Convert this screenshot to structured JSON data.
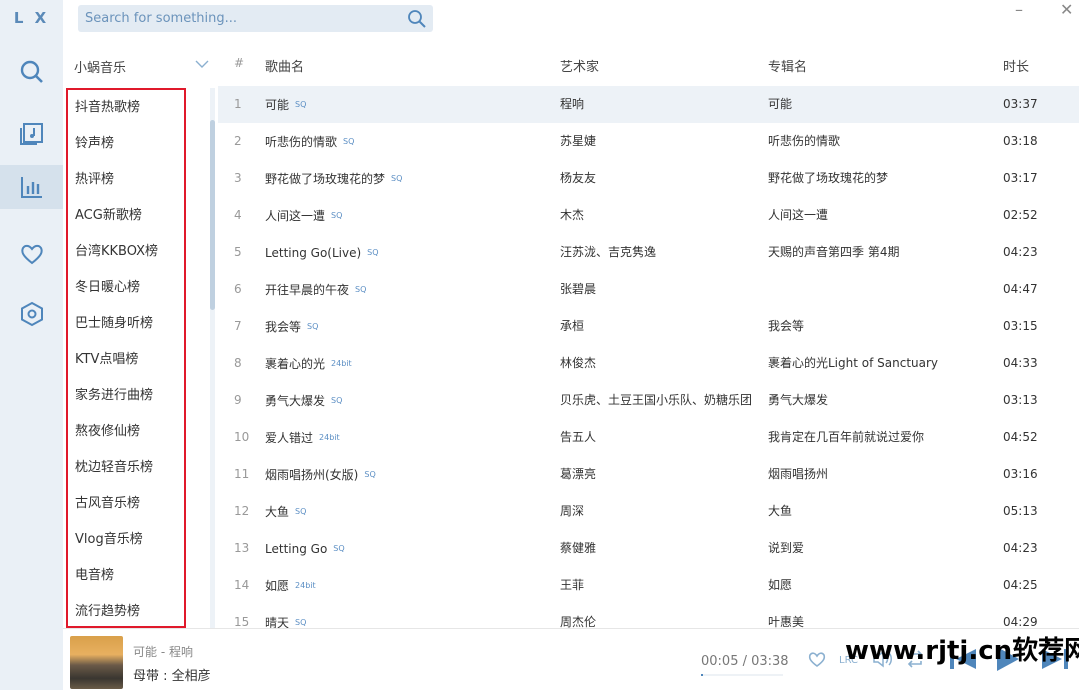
{
  "app": {
    "logo": "L X"
  },
  "search": {
    "placeholder": "Search for something..."
  },
  "source": {
    "selected": "小蜗音乐"
  },
  "boards": [
    "抖音热歌榜",
    "铃声榜",
    "热评榜",
    "ACG新歌榜",
    "台湾KKBOX榜",
    "冬日暖心榜",
    "巴士随身听榜",
    "KTV点唱榜",
    "家务进行曲榜",
    "熬夜修仙榜",
    "枕边轻音乐榜",
    "古风音乐榜",
    "Vlog音乐榜",
    "电音榜",
    "流行趋势榜"
  ],
  "table": {
    "headers": [
      "#",
      "歌曲名",
      "艺术家",
      "专辑名",
      "时长"
    ],
    "rows": [
      {
        "n": "1",
        "title": "可能",
        "q": "SQ",
        "artist": "程响",
        "album": "可能",
        "dur": "03:37"
      },
      {
        "n": "2",
        "title": "听悲伤的情歌",
        "q": "SQ",
        "artist": "苏星婕",
        "album": "听悲伤的情歌",
        "dur": "03:18"
      },
      {
        "n": "3",
        "title": "野花做了场玫瑰花的梦",
        "q": "SQ",
        "artist": "杨友友",
        "album": "野花做了场玫瑰花的梦",
        "dur": "03:17"
      },
      {
        "n": "4",
        "title": "人间这一遭",
        "q": "SQ",
        "artist": "木杰",
        "album": "人间这一遭",
        "dur": "02:52"
      },
      {
        "n": "5",
        "title": "Letting Go(Live)",
        "q": "SQ",
        "artist": "汪苏泷、吉克隽逸",
        "album": "天赐的声音第四季 第4期",
        "dur": "04:23"
      },
      {
        "n": "6",
        "title": "开往早晨的午夜",
        "q": "SQ",
        "artist": "张碧晨",
        "album": "",
        "dur": "04:47"
      },
      {
        "n": "7",
        "title": "我会等",
        "q": "SQ",
        "artist": "承桓",
        "album": "我会等",
        "dur": "03:15"
      },
      {
        "n": "8",
        "title": "裹着心的光",
        "q": "24bit",
        "artist": "林俊杰",
        "album": "裹着心的光Light of Sanctuary",
        "dur": "04:33"
      },
      {
        "n": "9",
        "title": "勇气大爆发",
        "q": "SQ",
        "artist": "贝乐虎、土豆王国小乐队、奶糖乐团",
        "album": "勇气大爆发",
        "dur": "03:13"
      },
      {
        "n": "10",
        "title": "爱人错过",
        "q": "24bit",
        "artist": "告五人",
        "album": "我肯定在几百年前就说过爱你",
        "dur": "04:52"
      },
      {
        "n": "11",
        "title": "烟雨唱扬州(女版)",
        "q": "SQ",
        "artist": "葛漂亮",
        "album": "烟雨唱扬州",
        "dur": "03:16"
      },
      {
        "n": "12",
        "title": "大鱼",
        "q": "SQ",
        "artist": "周深",
        "album": "大鱼",
        "dur": "05:13"
      },
      {
        "n": "13",
        "title": "Letting Go",
        "q": "SQ",
        "artist": "蔡健雅",
        "album": "说到爱",
        "dur": "04:23"
      },
      {
        "n": "14",
        "title": "如愿",
        "q": "24bit",
        "artist": "王菲",
        "album": "如愿",
        "dur": "04:25"
      },
      {
        "n": "15",
        "title": "晴天",
        "q": "SQ",
        "artist": "周杰伦",
        "album": "叶惠美",
        "dur": "04:29"
      }
    ]
  },
  "player": {
    "title": "可能 - 程响",
    "lyric": "母带 : 全相彦",
    "time": "00:05 / 03:38",
    "progress": 0.023
  },
  "watermark": "www.rjtj.cn软荐网"
}
